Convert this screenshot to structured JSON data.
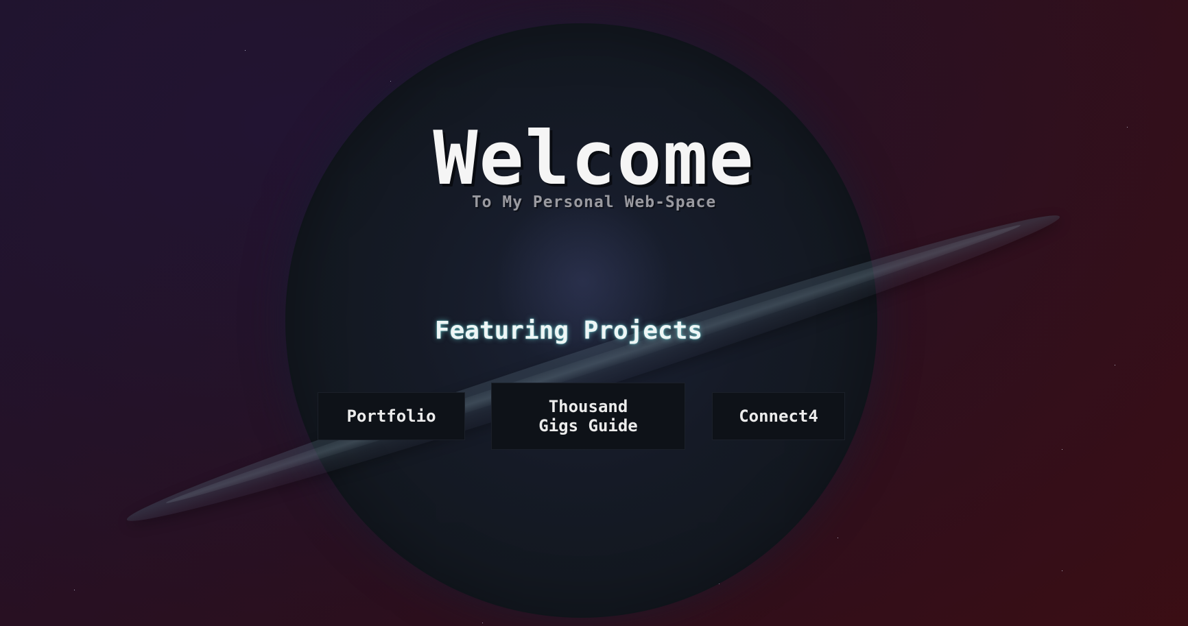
{
  "hero": {
    "title": "Welcome",
    "subtitle": "To My Personal Web-Space"
  },
  "projects": {
    "heading": "Featuring Projects",
    "items": [
      {
        "label": "Portfolio"
      },
      {
        "label_line1": "Thousand",
        "label_line2": "Gigs Guide"
      },
      {
        "label": "Connect4"
      }
    ]
  },
  "colors": {
    "title": "#f5f5f5",
    "subtitle": "#9a9aa0",
    "heading_glow": "#78e6e6",
    "button_bg": "#0e1218",
    "planet": "#151a26"
  }
}
